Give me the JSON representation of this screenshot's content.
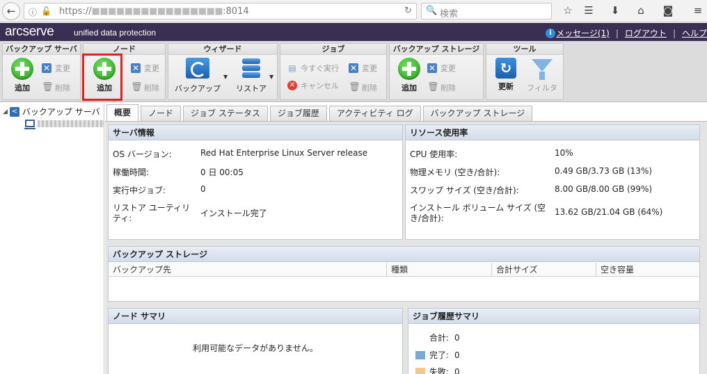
{
  "browser": {
    "url_prefix": "https://",
    "url_hidden": "■■■■■■■■■■■■■■■■",
    "url_suffix": ":8014",
    "search_placeholder": "検索"
  },
  "header": {
    "logo": "arcserve",
    "logo_sub": "unified data protection",
    "info_icon_text": "i",
    "messages": "メッセージ(1)",
    "separator": "|",
    "logout": "ログアウト",
    "help": "ヘルプ"
  },
  "ribbon": {
    "backup_server": {
      "title": "バックアップ サーバ",
      "add": "追加",
      "edit": "変更",
      "delete": "削除"
    },
    "node": {
      "title": "ノード",
      "add": "追加",
      "edit": "変更",
      "delete": "削除"
    },
    "wizard": {
      "title": "ウィザード",
      "backup": "バックアップ",
      "restore": "リストア"
    },
    "job": {
      "title": "ジョブ",
      "run_now": "今すぐ実行",
      "cancel": "キャンセル",
      "edit": "変更",
      "delete": "削除"
    },
    "storage": {
      "title": "バックアップ ストレージ",
      "add": "追加",
      "edit": "変更",
      "delete": "削除"
    },
    "tools": {
      "title": "ツール",
      "refresh": "更新",
      "filter": "フィルタ"
    }
  },
  "tree": {
    "root": "バックアップ サーバ"
  },
  "tabs": [
    {
      "label": "概要"
    },
    {
      "label": "ノード"
    },
    {
      "label": "ジョブ ステータス"
    },
    {
      "label": "ジョブ履歴"
    },
    {
      "label": "アクティビティ ログ"
    },
    {
      "label": "バックアップ ストレージ"
    }
  ],
  "server_info": {
    "title": "サーバ情報",
    "os_label": "OS バージョン:",
    "os_value": "Red Hat Enterprise Linux Server release",
    "uptime_label": "稼働時間:",
    "uptime_value": "0 日 00:05",
    "running_label": "実行中ジョブ:",
    "running_value": "0",
    "restore_util_label_1": "リストア ユーティリ",
    "restore_util_label_2": "ティ:",
    "restore_util_value": "インストール完了"
  },
  "resources": {
    "title": "リソース使用率",
    "cpu_label": "CPU 使用率:",
    "cpu_value": "10%",
    "mem_label": "物理メモリ (空き/合計):",
    "mem_value": "0.49 GB/3.73 GB (13%)",
    "swap_label": "スワップ サイズ (空き/合計):",
    "swap_value": "8.00 GB/8.00 GB (99%)",
    "vol_label_1": "インストール ボリューム サイズ (空",
    "vol_label_2": "き/合計):",
    "vol_value": "13.62 GB/21.04 GB (64%)"
  },
  "backup_storage": {
    "title": "バックアップ ストレージ",
    "columns": [
      "バックアップ先",
      "種類",
      "合計サイズ",
      "空き容量"
    ]
  },
  "node_summary": {
    "title": "ノード サマリ",
    "empty": "利用可能なデータがありません。"
  },
  "job_summary": {
    "title": "ジョブ履歴サマリ",
    "total_label": "合計:",
    "total_value": "0",
    "done_label": "完了:",
    "done_value": "0",
    "fail_label": "失敗:",
    "fail_value": "0",
    "colors": {
      "done": "#7aa9d6",
      "fail": "#f2c98a"
    }
  }
}
